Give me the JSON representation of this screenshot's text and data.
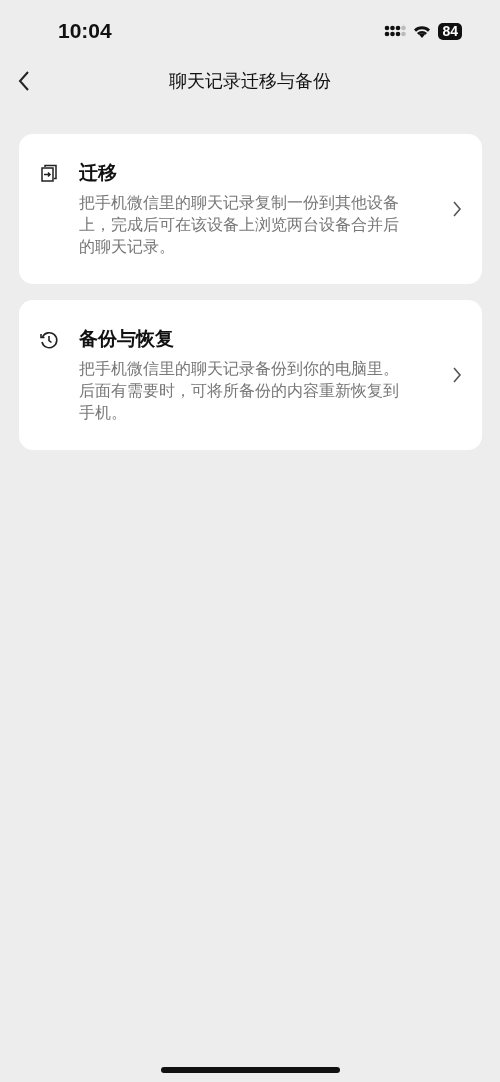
{
  "status_bar": {
    "time": "10:04",
    "battery": "84"
  },
  "nav": {
    "title": "聊天记录迁移与备份"
  },
  "cards": [
    {
      "kind": "migrate",
      "title": "迁移",
      "description": "把手机微信里的聊天记录复制一份到其他设备上，完成后可在该设备上浏览两台设备合并后的聊天记录。"
    },
    {
      "kind": "backup",
      "title": "备份与恢复",
      "description": "把手机微信里的聊天记录备份到你的电脑里。后面有需要时，可将所备份的内容重新恢复到手机。"
    }
  ]
}
